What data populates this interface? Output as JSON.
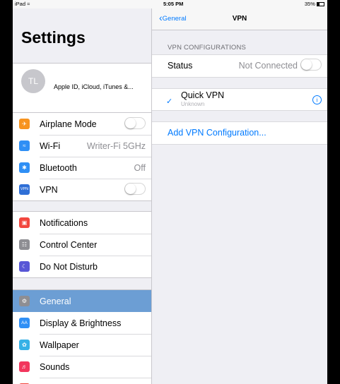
{
  "statusbar": {
    "device": "iPad",
    "time": "5:05 PM",
    "battery": "35%"
  },
  "master": {
    "title": "Settings",
    "profile": {
      "initials": "TL",
      "subtitle": "Apple ID, iCloud, iTunes &..."
    },
    "groups": [
      [
        {
          "label": "Airplane Mode",
          "icon": "airplane-icon",
          "color": "#f7931e",
          "control": "toggle"
        },
        {
          "label": "Wi-Fi",
          "icon": "wifi-icon",
          "color": "#2f8ff5",
          "value": "Writer-Fi 5GHz"
        },
        {
          "label": "Bluetooth",
          "icon": "bluetooth-icon",
          "color": "#2f8ff5",
          "value": "Off"
        },
        {
          "label": "VPN",
          "icon": "vpn-icon",
          "color": "#2f6fd6",
          "control": "toggle"
        }
      ],
      [
        {
          "label": "Notifications",
          "icon": "notifications-icon",
          "color": "#f2463e"
        },
        {
          "label": "Control Center",
          "icon": "control-center-icon",
          "color": "#8e8e93"
        },
        {
          "label": "Do Not Disturb",
          "icon": "moon-icon",
          "color": "#5856d6"
        }
      ],
      [
        {
          "label": "General",
          "icon": "gear-icon",
          "color": "#8e8e93",
          "selected": true
        },
        {
          "label": "Display & Brightness",
          "icon": "display-icon",
          "color": "#2f8ff5"
        },
        {
          "label": "Wallpaper",
          "icon": "wallpaper-icon",
          "color": "#36b1e6"
        },
        {
          "label": "Sounds",
          "icon": "speaker-icon",
          "color": "#f2365d"
        }
      ]
    ]
  },
  "detail": {
    "back_label": "General",
    "nav_title": "VPN",
    "section_header": "VPN CONFIGURATIONS",
    "status_label": "Status",
    "status_value": "Not Connected",
    "vpn_name": "Quick VPN",
    "vpn_status": "Unknown",
    "add_label": "Add VPN Configuration..."
  }
}
